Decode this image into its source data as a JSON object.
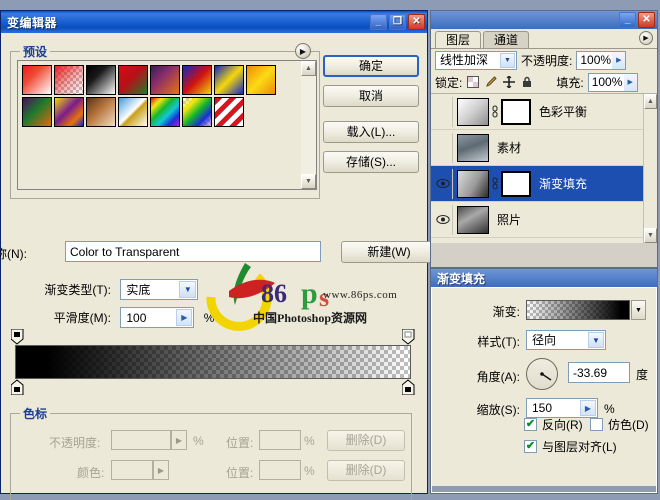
{
  "gradient_editor": {
    "title": "变编辑器",
    "window_buttons": {
      "minimize": "_",
      "maximize": "❐",
      "close": "✕"
    },
    "presets": {
      "label": "预设",
      "menu_icon": "▶",
      "scroll_up_icon": "▲",
      "scroll_down_icon": "▼",
      "swatches": [
        {
          "name": "前景色到背景色",
          "css": "linear-gradient(135deg,#e8201e 0%,#ef4a35 35%,#ffffff 100%)"
        },
        {
          "name": "前景色到透明",
          "css": "linear-gradient(135deg,#e8201e 0%,rgba(232,32,30,0.35) 55%,rgba(232,32,30,0) 100%)"
        },
        {
          "name": "黑色到白色",
          "css": "linear-gradient(135deg,#000000 0%,#1a1a1a 35%,#ffffff 100%)"
        },
        {
          "name": "红绿",
          "css": "linear-gradient(135deg,#d10f12 0%,#b81018 45%,#1f7a2c 100%)"
        },
        {
          "name": "紫橙",
          "css": "linear-gradient(135deg,#3a1a5c 0%,#8c2f6a 40%,#e8730f 100%)"
        },
        {
          "name": "蓝红黄",
          "css": "linear-gradient(135deg,#1125c8 0%,#d01010 50%,#f2d211 100%)"
        },
        {
          "name": "蓝黄蓝",
          "css": "linear-gradient(135deg,#1125c8 0%,#f5d80a 50%,#1125c8 100%)"
        },
        {
          "name": "橙黄橙",
          "css": "linear-gradient(135deg,#f08a08 0%,#fbdb16 50%,#f08a08 100%)"
        },
        {
          "name": "紫绿橙",
          "css": "linear-gradient(135deg,#4b1060 0%,#1f7a2c 45%,#e06a0c 100%)"
        },
        {
          "name": "黄紫橙蓝",
          "css": "linear-gradient(135deg,#f5d80a 0%,#7b1b8c 45%,#e8720d 75%,#1125c8 100%)"
        },
        {
          "name": "铜色",
          "css": "linear-gradient(135deg,#5d3316 0%,#b9773e 45%,#f0ddc8 100%)"
        },
        {
          "name": "铬黄",
          "css": "linear-gradient(135deg,#3f9ae0 0%,#ffffff 48%,#c8a11a 55%,#ffffff 100%)"
        },
        {
          "name": "色谱",
          "css": "linear-gradient(135deg,#e8101a 0%,#f5e60c 20%,#15b82a 40%,#12c8d8 60%,#1a2ed8 80%,#c01ad8 100%)"
        },
        {
          "name": "透明彩虹",
          "css": "linear-gradient(135deg,rgba(232,16,26,0) 0%,#f5e60c 25%,#15b82a 50%,#1a2ed8 75%,rgba(192,26,216,0.2) 100%)"
        },
        {
          "name": "透明条纹",
          "css": "repeating-linear-gradient(135deg,#d81420 0px,#d81420 5px,#ffffff 5px,#ffffff 10px)"
        }
      ]
    },
    "buttons": {
      "ok": "确定",
      "cancel": "取消",
      "load": "载入(L)...",
      "save": "存储(S)...",
      "new": "新建(W)"
    },
    "name_field": {
      "label": "称(N):",
      "value": "Color to Transparent"
    },
    "gradient_type": {
      "label": "渐变类型(T):",
      "value": "实底",
      "arrow": "▼"
    },
    "smoothness": {
      "label": "平滑度(M):",
      "value": "100",
      "unit": "%",
      "arrow": "▶"
    },
    "color_stops_section": {
      "label": "色标",
      "opacity_label": "不透明度:",
      "opacity_value": "",
      "opacity_unit": "%",
      "opacity_location_label": "位置:",
      "opacity_location_value": "",
      "opacity_location_unit": "%",
      "opacity_delete": "删除(D)",
      "color_label": "颜色:",
      "color_value": "",
      "color_location_label": "位置:",
      "color_location_value": "",
      "color_location_unit": "%",
      "color_delete": "删除(D)"
    }
  },
  "watermark": {
    "number": "86",
    "p": "p",
    "s": "s",
    "url": "www.86ps.com",
    "site": "中国Photoshop资源网"
  },
  "layers_palette": {
    "window_buttons": {
      "minimize": "_",
      "close": "✕"
    },
    "tabs": [
      {
        "label": "图层",
        "active": true
      },
      {
        "label": "通道",
        "active": false
      }
    ],
    "menu_icon": "▶",
    "blend_mode": "线性加深",
    "opacity_label": "不透明度:",
    "opacity_value": "100%",
    "lock_label": "锁定:",
    "lock_icons": [
      "transparency-icon",
      "brush-icon",
      "move-icon",
      "lock-icon"
    ],
    "fill_label": "填充:",
    "fill_value": "100%",
    "layers": [
      {
        "name": "色彩平衡",
        "visible": false,
        "selected": false,
        "has_mask": true,
        "linked": true
      },
      {
        "name": "素材",
        "visible": false,
        "selected": false,
        "has_mask": false,
        "linked": false
      },
      {
        "name": "渐变填充",
        "visible": true,
        "selected": true,
        "has_mask": true,
        "linked": true
      },
      {
        "name": "照片",
        "visible": true,
        "selected": false,
        "has_mask": false,
        "linked": false
      }
    ],
    "scroll_up_icon": "▲",
    "scroll_down_icon": "▼"
  },
  "gradient_fill_dialog": {
    "title": "渐变填充",
    "gradient_label": "渐变:",
    "gradient_arrow": "▼",
    "style_label": "样式(T):",
    "style_value": "径向",
    "style_arrow": "▼",
    "angle_label": "角度(A):",
    "angle_value": "-33.69",
    "angle_unit": "度",
    "scale_label": "缩放(S):",
    "scale_value": "150",
    "scale_unit": "%",
    "scale_arrow": "▶",
    "checkboxes": [
      {
        "label": "反向(R)",
        "checked": true
      },
      {
        "label": "仿色(D)",
        "checked": false
      },
      {
        "label": "与图层对齐(L)",
        "checked": true
      }
    ],
    "check_glyph": "✔"
  }
}
